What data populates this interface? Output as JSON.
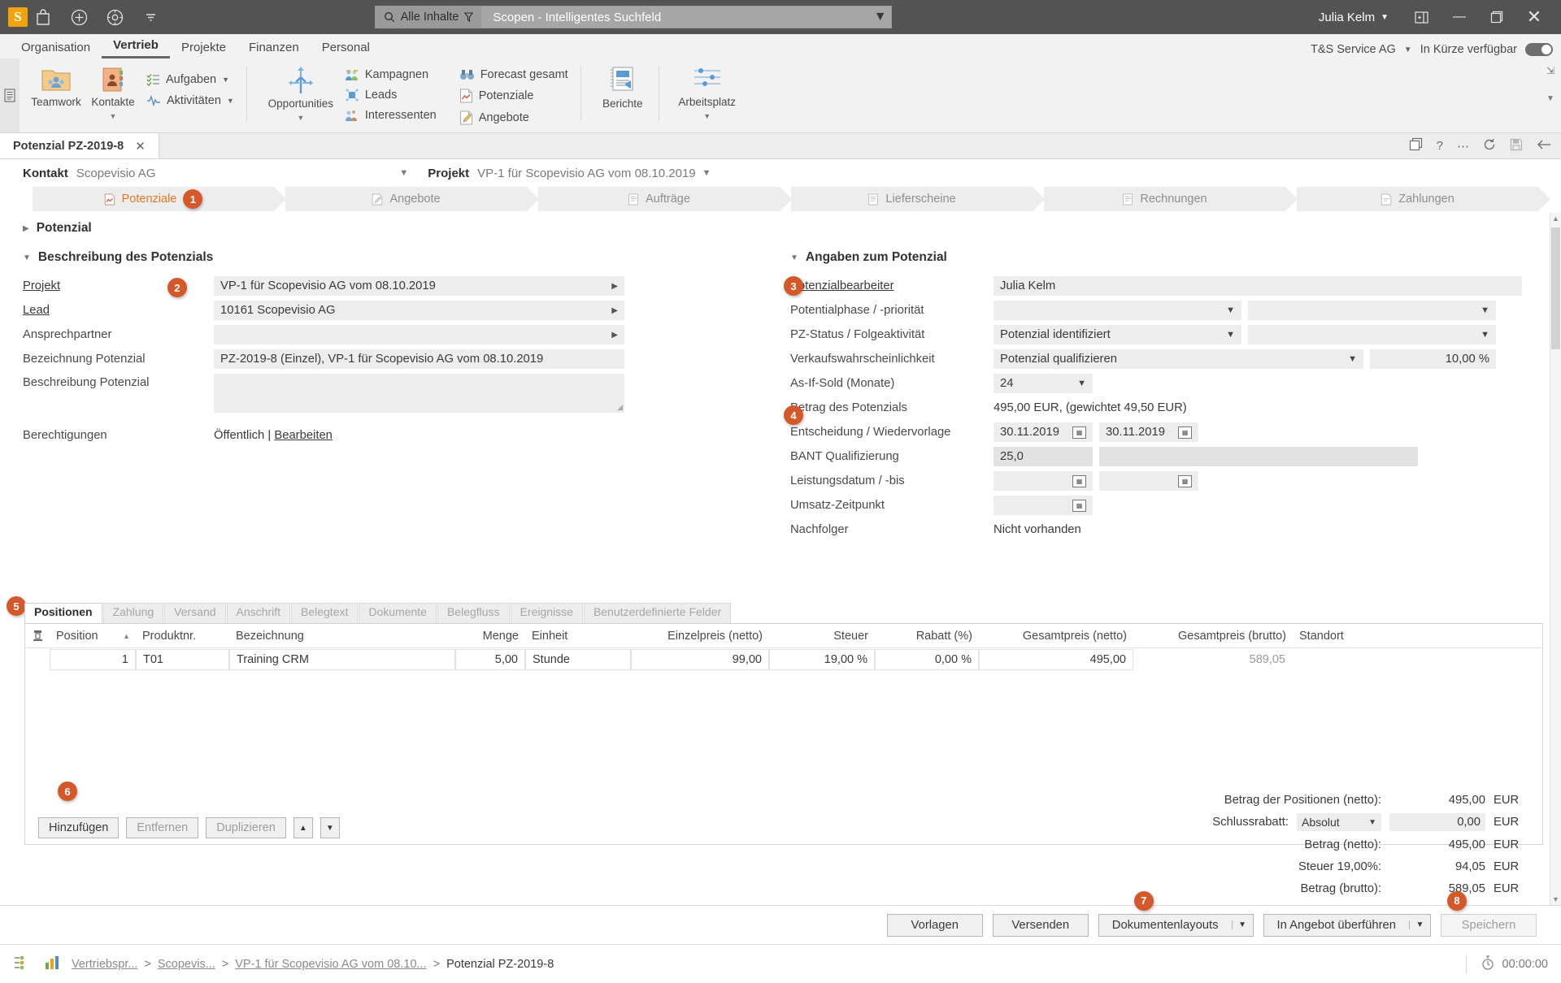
{
  "titlebar": {
    "logo": "S",
    "icons": [
      "bag-icon",
      "plus-circle-icon",
      "compass-icon",
      "chevron-down-icon"
    ],
    "search_category": "Alle Inhalte",
    "search_placeholder": "Scopen - Intelligentes Suchfeld",
    "user": "Julia Kelm",
    "window_icon": "restore-pane-icon",
    "minimize": "—",
    "maximize": "❐",
    "close": "✕"
  },
  "menubar": {
    "items": [
      {
        "label": "Organisation",
        "active": false
      },
      {
        "label": "Vertrieb",
        "active": true
      },
      {
        "label": "Projekte",
        "active": false
      },
      {
        "label": "Finanzen",
        "active": false
      },
      {
        "label": "Personal",
        "active": false
      }
    ],
    "company": "T&S Service AG",
    "availability": "In Kürze verfügbar"
  },
  "ribbon": {
    "groups": [
      {
        "big": [
          {
            "label": "Teamwork",
            "icon": "teamwork-folder-icon",
            "caret": false
          },
          {
            "label": "Kontakte",
            "icon": "contacts-book-icon",
            "caret": true
          }
        ],
        "small": [
          {
            "label": "Aufgaben",
            "icon": "tasks-icon",
            "caret": true
          },
          {
            "label": "Aktivitäten",
            "icon": "activities-icon",
            "caret": true
          }
        ]
      },
      {
        "big": [
          {
            "label": "Opportunities",
            "icon": "opportunities-arrows-icon",
            "caret": true
          }
        ],
        "small": [
          {
            "label": "Kampagnen",
            "icon": "campaigns-icon",
            "caret": false
          },
          {
            "label": "Leads",
            "icon": "leads-icon",
            "caret": false
          },
          {
            "label": "Interessenten",
            "icon": "prospects-icon",
            "caret": false
          }
        ]
      },
      {
        "small": [
          {
            "label": "Forecast gesamt",
            "icon": "binoculars-icon",
            "caret": false
          },
          {
            "label": "Potenziale",
            "icon": "potentials-chart-icon",
            "caret": false
          },
          {
            "label": "Angebote",
            "icon": "quotes-icon",
            "caret": false
          }
        ]
      },
      {
        "big": [
          {
            "label": "Berichte",
            "icon": "reports-icon",
            "caret": false
          }
        ]
      },
      {
        "big": [
          {
            "label": "Arbeitsplatz",
            "icon": "workplace-icon",
            "caret": true
          }
        ]
      }
    ]
  },
  "doctab": {
    "title": "Potenzial PZ-2019-8",
    "close": "✕",
    "actions": [
      "copy-icon",
      "help-icon",
      "more-icon",
      "refresh-icon",
      "save-icon",
      "back-icon"
    ]
  },
  "context": {
    "kontakt_label": "Kontakt",
    "kontakt_value": "Scopevisio AG",
    "projekt_label": "Projekt",
    "projekt_value": "VP-1 für Scopevisio AG vom 08.10.2019"
  },
  "process_steps": [
    {
      "label": "Potenziale",
      "icon": "potentials-chart-icon",
      "active": true,
      "badge": "1"
    },
    {
      "label": "Angebote",
      "icon": "quotes-icon",
      "active": false
    },
    {
      "label": "Aufträge",
      "icon": "orders-icon",
      "active": false
    },
    {
      "label": "Lieferscheine",
      "icon": "delivery-notes-icon",
      "active": false
    },
    {
      "label": "Rechnungen",
      "icon": "invoices-icon",
      "active": false
    },
    {
      "label": "Zahlungen",
      "icon": "payments-icon",
      "active": false
    }
  ],
  "collapsed_section": "Potenzial",
  "left_section": {
    "title": "Beschreibung des Potenzials",
    "badge": "2",
    "fields": [
      {
        "label": "Projekt",
        "value": "VP-1 für Scopevisio AG vom 08.10.2019",
        "type": "lookup",
        "underline": true
      },
      {
        "label": "Lead",
        "value": "10161 Scopevisio AG",
        "type": "lookup",
        "underline": true
      },
      {
        "label": "Ansprechpartner",
        "value": "",
        "type": "lookup",
        "underline": false
      },
      {
        "label": "Bezeichnung Potenzial",
        "value": "PZ-2019-8 (Einzel), VP-1 für Scopevisio AG vom 08.10.2019",
        "type": "text",
        "underline": false
      },
      {
        "label": "Beschreibung Potenzial",
        "value": "",
        "type": "textarea",
        "underline": false
      }
    ],
    "permissions_label": "Berechtigungen",
    "permissions_value": "Öffentlich",
    "permissions_sep": "|",
    "permissions_edit": "Bearbeiten"
  },
  "right_section": {
    "title": "Angaben zum Potenzial",
    "badge_3": "3",
    "badge_4": "4",
    "fields": [
      {
        "label": "Potenzialbearbeiter",
        "value": "Julia Kelm",
        "type": "plain",
        "underline": true
      },
      {
        "label": "Potentialphase / -priorität",
        "value": "",
        "value2": "",
        "type": "dual-select"
      },
      {
        "label": "PZ-Status / Folgeaktivität",
        "value": "Potenzial identifiziert",
        "value2": "",
        "type": "dual-select"
      },
      {
        "label": "Verkaufswahrscheinlichkeit",
        "value": "Potenzial qualifizieren",
        "value2": "10,00 %",
        "type": "select-percent"
      },
      {
        "label": "As-If-Sold (Monate)",
        "value": "24",
        "type": "select-small"
      },
      {
        "label": "Betrag des Potenzials",
        "value": "495,00 EUR, (gewichtet 49,50 EUR)",
        "type": "plain"
      },
      {
        "label": "Entscheidung / Wiedervorlage",
        "value": "30.11.2019",
        "value2": "30.11.2019",
        "type": "dual-date"
      },
      {
        "label": "BANT Qualifizierung",
        "value": "25,0",
        "value2": "",
        "type": "dual-text"
      },
      {
        "label": "Leistungsdatum / -bis",
        "value": "",
        "value2": "",
        "type": "dual-date"
      },
      {
        "label": "Umsatz-Zeitpunkt",
        "value": "",
        "type": "date"
      },
      {
        "label": "Nachfolger",
        "value": "Nicht vorhanden",
        "type": "plain"
      }
    ]
  },
  "positions": {
    "badge": "5",
    "tabs": [
      {
        "label": "Positionen",
        "active": true
      },
      {
        "label": "Zahlung",
        "active": false
      },
      {
        "label": "Versand",
        "active": false
      },
      {
        "label": "Anschrift",
        "active": false
      },
      {
        "label": "Belegtext",
        "active": false
      },
      {
        "label": "Dokumente",
        "active": false
      },
      {
        "label": "Belegfluss",
        "active": false
      },
      {
        "label": "Ereignisse",
        "active": false
      },
      {
        "label": "Benutzerdefinierte Felder",
        "active": false
      }
    ],
    "columns": [
      "Position",
      "Produktnr.",
      "Bezeichnung",
      "Menge",
      "Einheit",
      "Einzelpreis (netto)",
      "Steuer",
      "Rabatt (%)",
      "Gesamtpreis (netto)",
      "Gesamtpreis (brutto)",
      "Standort"
    ],
    "sort_indicator": "▲",
    "row_menu_icon": "column-chooser-icon",
    "rows": [
      {
        "position": "1",
        "produktnr": "T01",
        "bezeichnung": "Training CRM",
        "menge": "5,00",
        "einheit": "Stunde",
        "einzelpreis": "99,00",
        "steuer": "19,00 %",
        "rabatt": "0,00 %",
        "gesamt_netto": "495,00",
        "gesamt_brutto": "589,05",
        "standort": ""
      }
    ],
    "buttons": {
      "badge": "6",
      "add": "Hinzufügen",
      "remove": "Entfernen",
      "duplicate": "Duplizieren",
      "up": "▲",
      "down": "▼"
    }
  },
  "totals": {
    "rows": [
      {
        "label": "Betrag der Positionen (netto):",
        "value": "495,00",
        "currency": "EUR",
        "type": "plain"
      },
      {
        "label": "Schlussrabatt:",
        "select": "Absolut",
        "value": "0,00",
        "currency": "EUR",
        "type": "discount"
      },
      {
        "label": "Betrag (netto):",
        "value": "495,00",
        "currency": "EUR",
        "type": "plain"
      },
      {
        "label": "Steuer 19,00%:",
        "value": "94,05",
        "currency": "EUR",
        "type": "plain"
      },
      {
        "label": "Betrag (brutto):",
        "value": "589,05",
        "currency": "EUR",
        "type": "plain"
      }
    ]
  },
  "footer": {
    "badge_7": "7",
    "badge_8": "8",
    "buttons": [
      {
        "label": "Vorlagen",
        "type": "plain",
        "disabled": false
      },
      {
        "label": "Versenden",
        "type": "plain",
        "disabled": false
      },
      {
        "label": "Dokumentenlayouts",
        "type": "split",
        "disabled": false
      },
      {
        "label": "In Angebot überführen",
        "type": "split",
        "disabled": false
      },
      {
        "label": "Speichern",
        "type": "plain",
        "disabled": true
      }
    ]
  },
  "statusbar": {
    "icons": [
      "workflow-icon",
      "chart-icon"
    ],
    "crumbs": [
      {
        "label": "Vertriebspr...",
        "current": false
      },
      {
        "label": "Scopevis...",
        "current": false
      },
      {
        "label": "VP-1 für Scopevisio AG vom 08.10...",
        "current": false
      },
      {
        "label": "Potenzial PZ-2019-8",
        "current": true
      }
    ],
    "separator": ">",
    "timer_icon": "stopwatch-icon",
    "timer": "00:00:00"
  },
  "colors": {
    "accent": "#d4582a",
    "active_text": "#e8761f",
    "titlebar": "#535353",
    "field": "#ededed"
  }
}
